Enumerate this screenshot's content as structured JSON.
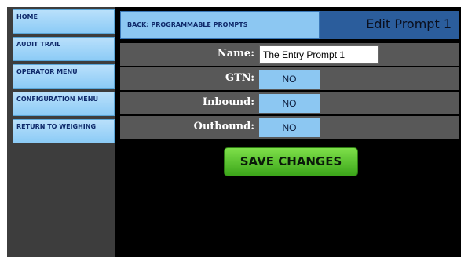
{
  "sidebar": {
    "items": [
      {
        "label": "HOME"
      },
      {
        "label": "AUDIT TRAIL"
      },
      {
        "label": "OPERATOR MENU"
      },
      {
        "label": "CONFIGURATION MENU"
      },
      {
        "label": "RETURN TO WEIGHING"
      }
    ]
  },
  "header": {
    "back_label": "BACK: PROGRAMMABLE PROMPTS",
    "title": "Edit Prompt 1"
  },
  "form": {
    "name_label": "Name:",
    "name_value": "The Entry Prompt 1",
    "gtn_label": "GTN:",
    "gtn_value": "NO",
    "inbound_label": "Inbound:",
    "inbound_value": "NO",
    "outbound_label": "Outbound:",
    "outbound_value": "NO"
  },
  "actions": {
    "save_label": "SAVE CHANGES"
  },
  "colors": {
    "button_blue": "#8cc7f2",
    "title_blue": "#2b5d9c",
    "save_green": "#4cc02a",
    "row_gray": "#585858"
  }
}
